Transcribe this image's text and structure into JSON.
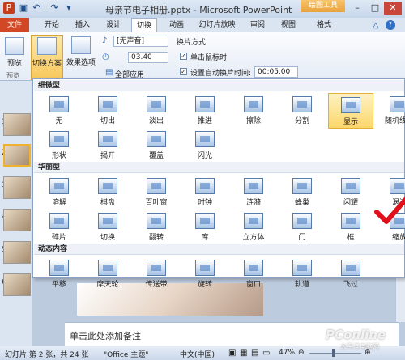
{
  "window": {
    "title": "母亲节电子相册.pptx - Microsoft PowerPoint",
    "context_tab": "绘图工具"
  },
  "tabs": [
    {
      "label": "文件"
    },
    {
      "label": "开始"
    },
    {
      "label": "插入"
    },
    {
      "label": "设计"
    },
    {
      "label": "切换"
    },
    {
      "label": "动画"
    },
    {
      "label": "幻灯片放映"
    },
    {
      "label": "审阅"
    },
    {
      "label": "视图"
    },
    {
      "label": "格式"
    }
  ],
  "ribbon": {
    "preview_label": "预览",
    "preview_group": "预览",
    "scheme_label": "切换方案",
    "effect_label": "效果选项",
    "sound_value": "[无声音]",
    "duration_value": "03.40",
    "apply_all_label": "全部应用",
    "switch_mode_label": "换片方式",
    "on_click_label": "单击鼠标时",
    "auto_time_label": "设置自动换片时间:",
    "auto_time_value": "00:05.00"
  },
  "gallery": {
    "sections": [
      {
        "title": "细微型",
        "items": [
          "无",
          "切出",
          "淡出",
          "推进",
          "擦除",
          "分割",
          "显示",
          "随机线条",
          "形状",
          "揭开",
          "覆盖",
          "闪光"
        ]
      },
      {
        "title": "华丽型",
        "items": [
          "溶解",
          "棋盘",
          "百叶窗",
          "时钟",
          "涟漪",
          "蜂巢",
          "闪耀",
          "涡流",
          "碎片",
          "切换",
          "翻转",
          "库",
          "立方体",
          "门",
          "框",
          "缩放"
        ]
      },
      {
        "title": "动态内容",
        "items": [
          "平移",
          "摩天轮",
          "传送带",
          "旋转",
          "窗口",
          "轨道",
          "飞过"
        ]
      }
    ],
    "selected": "显示"
  },
  "slides": [
    {
      "number": "1"
    },
    {
      "number": "2"
    },
    {
      "number": "3"
    },
    {
      "number": "4"
    },
    {
      "number": "5"
    },
    {
      "number": "6"
    }
  ],
  "notes_placeholder": "单击此处添加备注",
  "status": {
    "slide": "幻灯片 第 2 张，共 24 张",
    "theme": "\"Office 主题\"",
    "lang": "中文(中国)",
    "zoom": "47%"
  },
  "watermark": {
    "brand": "PConline",
    "sub": "太平洋电脑网"
  },
  "colors": {
    "file_tab": "#d24726",
    "selected_item": "#fbd66a",
    "checkmark": "#e0101a"
  }
}
